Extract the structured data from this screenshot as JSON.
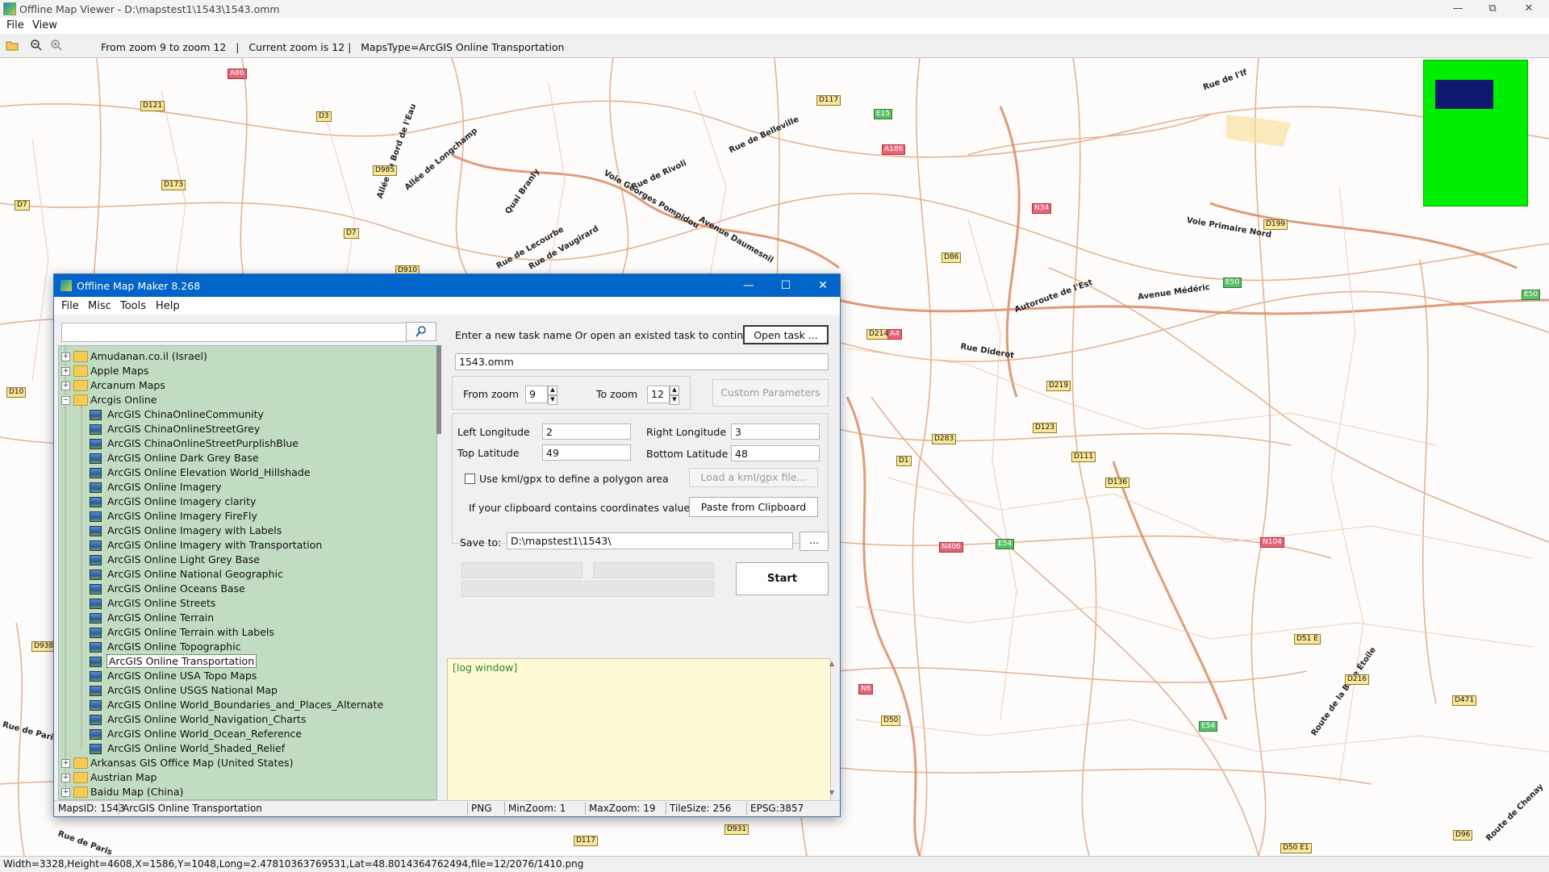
{
  "window": {
    "title": "Offline Map Viewer - D:\\mapstest1\\1543\\1543.omm",
    "menu": [
      "File",
      "View"
    ],
    "toolbar_info": "From zoom 9 to zoom 12   |   Current zoom is 12 |   MapsType=ArcGIS Online Transportation",
    "status": "Width=3328,Height=4608,X=1586,Y=1048,Long=2.47810363769531,Lat=48.8014364762494,file=12/2076/1410.png"
  },
  "map_labels": {
    "streets": [
      "Rue de l'If",
      "Rue de Belleville",
      "Allée de Longchamp",
      "Allée du Bord de l'Eau",
      "Quai Branly",
      "Rue de Rivoli",
      "Voie Georges Pompidou",
      "Rue de Lecourbe",
      "Rue de Vaugirard",
      "Avenue Daumesnil",
      "Rue Diderot",
      "Autoroute de l'Est",
      "Avenue Médéric",
      "Voie Primaire Nord",
      "Rue de Paris",
      "Route de la Belle Étoile",
      "Rue de Paris",
      "Route de Chenay"
    ],
    "shields": [
      "D121",
      "D173",
      "D7",
      "D3",
      "D985",
      "D117",
      "D910",
      "D214",
      "D86",
      "D219",
      "D123",
      "D283",
      "D111",
      "D136",
      "D199",
      "D10",
      "D938",
      "D117",
      "D931",
      "D50",
      "D51 E",
      "D216",
      "D471",
      "D96",
      "D50 E1",
      "D1",
      "D7"
    ],
    "red_shields": [
      "A86",
      "A186",
      "N34",
      "N406",
      "N104",
      "N6",
      "A4"
    ],
    "green_shields": [
      "E15",
      "E50",
      "E54",
      "E50",
      "E54"
    ]
  },
  "dialog": {
    "title": "Offline Map Maker 8.268",
    "menu": [
      "File",
      "Misc",
      "Tools",
      "Help"
    ],
    "search_placeholder": "",
    "search_icon": "magnifier-icon",
    "tree": {
      "top_folders_before": [
        "Amudanan.co.il (Israel)",
        "Apple Maps",
        "Arcanum Maps"
      ],
      "open_folder": "Arcgis Online",
      "children": [
        "ArcGIS ChinaOnlineCommunity",
        "ArcGIS ChinaOnlineStreetGrey",
        "ArcGIS ChinaOnlineStreetPurplishBlue",
        "ArcGIS Online Dark Grey Base",
        "ArcGIS Online Elevation World_Hillshade",
        "ArcGIS Online Imagery",
        "ArcGIS Online Imagery clarity",
        "ArcGIS Online Imagery FireFly",
        "ArcGIS Online Imagery with Labels",
        "ArcGIS Online Imagery with Transportation",
        "ArcGIS Online Light Grey Base",
        "ArcGIS Online National Geographic",
        "ArcGIS Online Oceans Base",
        "ArcGIS Online Streets",
        "ArcGIS Online Terrain",
        "ArcGIS Online Terrain with Labels",
        "ArcGIS Online Topographic",
        "ArcGIS Online Transportation",
        "ArcGIS Online USA Topo Maps",
        "ArcGIS Online USGS National Map",
        "ArcGIS Online World_Boundaries_and_Places_Alternate",
        "ArcGIS Online World_Navigation_Charts",
        "ArcGIS Online World_Ocean_Reference",
        "ArcGIS Online World_Shaded_Relief"
      ],
      "selected": "ArcGIS Online Transportation",
      "top_folders_after": [
        "Arkansas GIS Office Map (United States)",
        "Austrian Map",
        "Baidu Map (China)"
      ]
    },
    "task_prompt": "Enter a new task name Or open an existed task to continue:",
    "open_task_label": "Open task ...",
    "task_name": "1543.omm",
    "from_zoom_label": "From zoom",
    "from_zoom": "9",
    "to_zoom_label": "To zoom",
    "to_zoom": "12",
    "custom_params_label": "Custom Parameters",
    "left_lon_label": "Left Longitude",
    "left_lon": "2",
    "right_lon_label": "Right Longitude",
    "right_lon": "3",
    "top_lat_label": "Top Latitude",
    "top_lat": "49",
    "bottom_lat_label": "Bottom Latitude",
    "bottom_lat": "48",
    "kml_checkbox_label": "Use kml/gpx to define a polygon area",
    "kml_checked": false,
    "load_kml_label": "Load a kml/gpx file...",
    "clipboard_prompt": "If your clipboard contains coordinates values:",
    "paste_label": "Paste from Clipboard",
    "save_to_label": "Save to:",
    "save_to": "D:\\mapstest1\\1543\\",
    "browse_label": "...",
    "start_label": "Start",
    "log_text": "[log window]",
    "status": {
      "maps_id": "MapsID: 1543",
      "maps_name": "ArcGIS Online Transportation",
      "format": "PNG",
      "min_zoom": "MinZoom: 1",
      "max_zoom": "MaxZoom: 19",
      "tile_size": "TileSize: 256",
      "epsg": "EPSG:3857"
    }
  },
  "colors": {
    "dialog_title": "#0064c8",
    "tree_bg": "#c2dcc2",
    "log_bg": "#fefad6",
    "minimap": "#00ee00",
    "minimap_viewport": "#101870",
    "road": "#e0a07a"
  }
}
